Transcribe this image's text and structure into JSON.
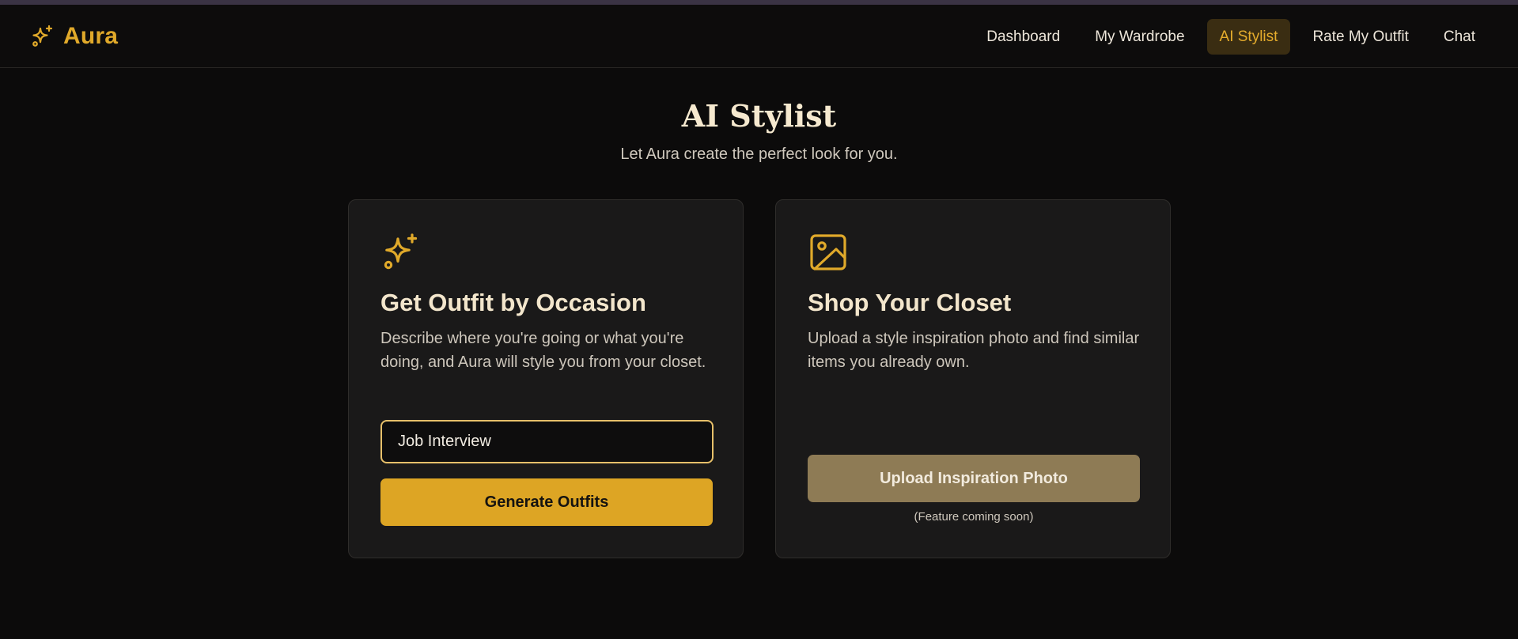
{
  "app": {
    "brand_name": "Aura",
    "brand_icon": "sparkles-icon",
    "accent_color": "#e0a92a"
  },
  "nav": {
    "items": [
      {
        "label": "Dashboard",
        "active": false
      },
      {
        "label": "My Wardrobe",
        "active": false
      },
      {
        "label": "AI Stylist",
        "active": true
      },
      {
        "label": "Rate My Outfit",
        "active": false
      },
      {
        "label": "Chat",
        "active": false
      }
    ]
  },
  "page": {
    "title": "AI Stylist",
    "subtitle": "Let Aura create the perfect look for you."
  },
  "occasion_card": {
    "icon": "sparkles-icon",
    "title": "Get Outfit by Occasion",
    "description": "Describe where you're going or what you're doing, and Aura will style you from your closet.",
    "input_value": "Job Interview",
    "button_label": "Generate Outfits"
  },
  "closet_card": {
    "icon": "image-icon",
    "title": "Shop Your Closet",
    "description": "Upload a style inspiration photo and find similar items you already own.",
    "button_label": "Upload Inspiration Photo",
    "note": "(Feature coming soon)"
  }
}
